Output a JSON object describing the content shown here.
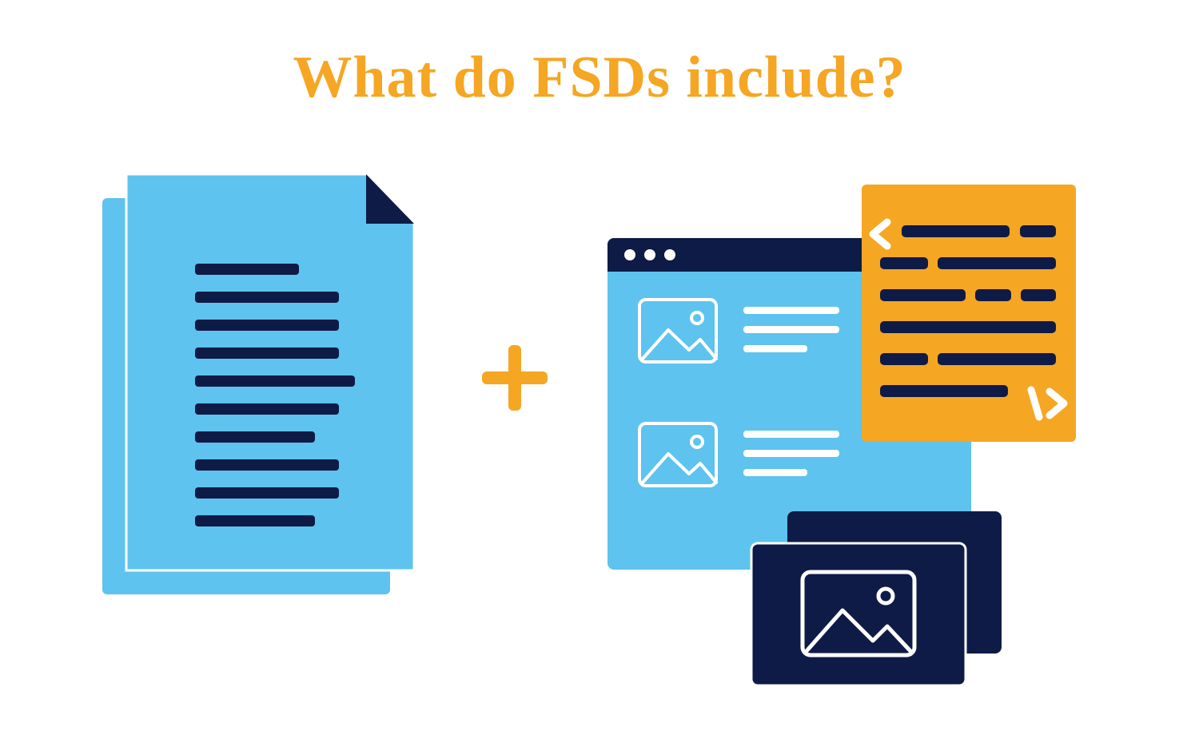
{
  "title": "What do FSDs include?",
  "colors": {
    "accent": "#f5a623",
    "sky": "#5ec3ee",
    "navy": "#0f1b47",
    "white": "#ffffff"
  },
  "icons": {
    "left": "documents-stack",
    "plus": "plus-icon",
    "right": {
      "browser": "browser-window",
      "code": "code-panel",
      "media": "image-card-stack"
    }
  }
}
